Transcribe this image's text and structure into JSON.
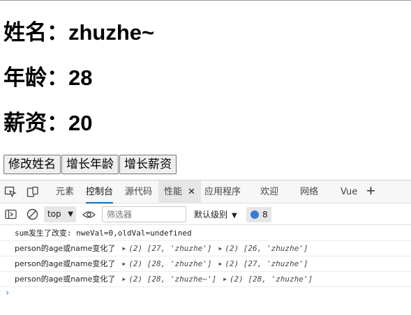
{
  "page": {
    "name_label": "姓名",
    "name_value": "zhuzhe~",
    "age_label": "年龄",
    "age_value": "28",
    "salary_label": "薪资",
    "salary_value": "20",
    "separator": "：",
    "buttons": {
      "change_name": "修改姓名",
      "grow_age": "增长年龄",
      "grow_salary": "增长薪资"
    }
  },
  "devtools": {
    "tabs": [
      {
        "label": "元素"
      },
      {
        "label": "控制台"
      },
      {
        "label": "源代码"
      },
      {
        "label": "性能"
      },
      {
        "label": "应用程序"
      },
      {
        "label": "欢迎"
      },
      {
        "label": "网络"
      },
      {
        "label": "Vue"
      }
    ],
    "active_tab": "控制台",
    "close_glyph": "✕",
    "plus_glyph": "+",
    "toolbar": {
      "context": "top",
      "filter_placeholder": "筛选器",
      "levels": "默认级别",
      "issues_count": "8"
    },
    "accent_color": "#0f6cbd",
    "console": [
      {
        "text": "sum发生了改变: nweVal=0,oldVal=undefined"
      },
      {
        "prefix": "person的age或name变化了",
        "a": "(2) [27, 'zhuzhe']",
        "b": "(2) [26, 'zhuzhe']"
      },
      {
        "prefix": "person的age或name变化了",
        "a": "(2) [28, 'zhuzhe']",
        "b": "(2) [27, 'zhuzhe']"
      },
      {
        "prefix": "person的age或name变化了",
        "a": "(2) [28, 'zhuzhe~']",
        "b": "(2) [28, 'zhuzhe']"
      }
    ],
    "prompt_glyph": "›"
  }
}
